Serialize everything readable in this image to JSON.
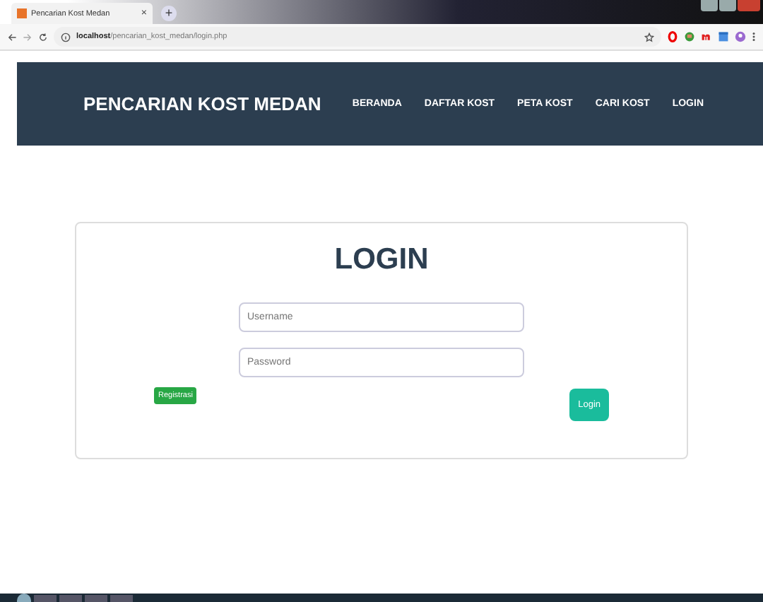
{
  "browser": {
    "tab_title": "Pencarian Kost Medan",
    "tab_close": "×",
    "new_tab": "+",
    "url_host": "localhost",
    "url_path": "/pencarian_kost_medan/login.php"
  },
  "navbar": {
    "brand": "PENCARIAN KOST MEDAN",
    "items": [
      {
        "label": "BERANDA"
      },
      {
        "label": "DAFTAR KOST"
      },
      {
        "label": "PETA KOST"
      },
      {
        "label": "CARI KOST"
      },
      {
        "label": "LOGIN"
      }
    ]
  },
  "login": {
    "title": "LOGIN",
    "username": {
      "placeholder": "Username"
    },
    "password": {
      "placeholder": "Password"
    },
    "register_button": "Registrasi",
    "login_button": "Login"
  }
}
